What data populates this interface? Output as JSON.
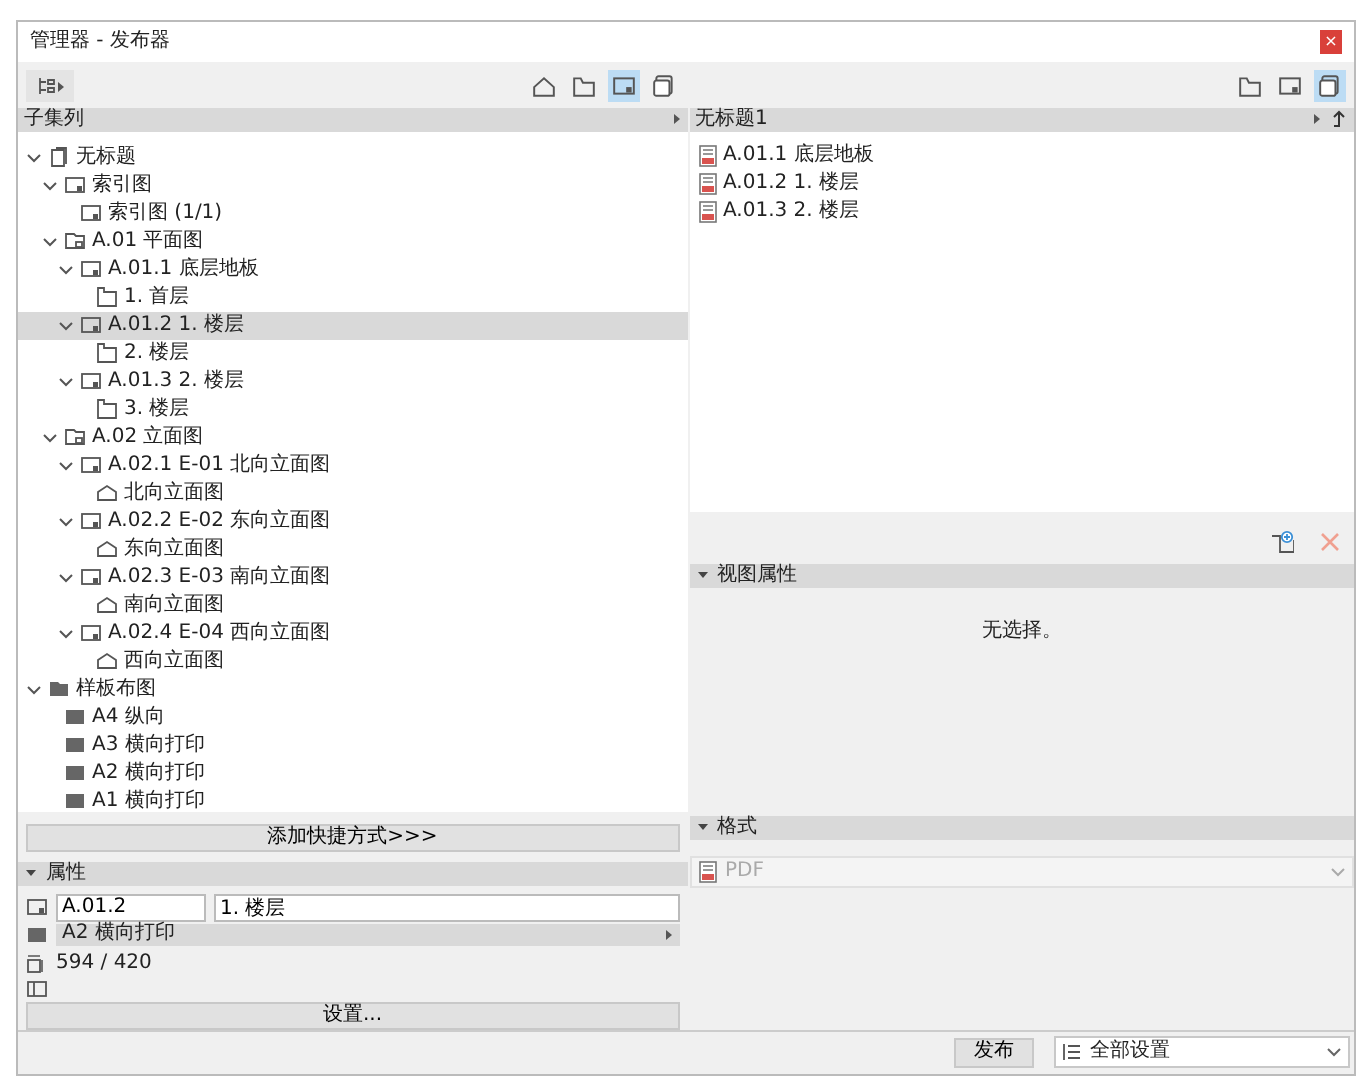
{
  "window": {
    "title": "管理器 - 发布器",
    "close": "×"
  },
  "left_pane": {
    "toolbar": {
      "view_buttons": [
        {
          "kind": "house",
          "selected": false
        },
        {
          "kind": "folder",
          "selected": false
        },
        {
          "kind": "layout",
          "selected": true
        },
        {
          "kind": "stack",
          "selected": false
        }
      ]
    },
    "header": "子集列",
    "tree": [
      {
        "label": "无标题",
        "kind": "book",
        "selected": false,
        "expanded": true,
        "children": [
          {
            "label": "索引图",
            "kind": "layout",
            "selected": false,
            "expanded": true,
            "children": [
              {
                "label": "索引图 (1/1)",
                "kind": "layout",
                "selected": false
              }
            ]
          },
          {
            "label": "A.01 平面图",
            "kind": "subset",
            "selected": false,
            "expanded": true,
            "children": [
              {
                "label": "A.01.1 底层地板",
                "kind": "layout",
                "selected": false,
                "expanded": true,
                "children": [
                  {
                    "label": "1. 首层",
                    "kind": "plan",
                    "selected": false
                  }
                ]
              },
              {
                "label": "A.01.2 1. 楼层",
                "kind": "layout",
                "selected": true,
                "expanded": true,
                "children": [
                  {
                    "label": "2. 楼层",
                    "kind": "plan",
                    "selected": false
                  }
                ]
              },
              {
                "label": "A.01.3 2. 楼层",
                "kind": "layout",
                "selected": false,
                "expanded": true,
                "children": [
                  {
                    "label": "3. 楼层",
                    "kind": "plan",
                    "selected": false
                  }
                ]
              }
            ]
          },
          {
            "label": "A.02 立面图",
            "kind": "subset",
            "selected": false,
            "expanded": true,
            "children": [
              {
                "label": "A.02.1 E-01 北向立面图",
                "kind": "layout",
                "selected": false,
                "expanded": true,
                "children": [
                  {
                    "label": "北向立面图",
                    "kind": "elevation",
                    "selected": false
                  }
                ]
              },
              {
                "label": "A.02.2 E-02 东向立面图",
                "kind": "layout",
                "selected": false,
                "expanded": true,
                "children": [
                  {
                    "label": "东向立面图",
                    "kind": "elevation",
                    "selected": false
                  }
                ]
              },
              {
                "label": "A.02.3 E-03 南向立面图",
                "kind": "layout",
                "selected": false,
                "expanded": true,
                "children": [
                  {
                    "label": "南向立面图",
                    "kind": "elevation",
                    "selected": false
                  }
                ]
              },
              {
                "label": "A.02.4 E-04 西向立面图",
                "kind": "layout",
                "selected": false,
                "expanded": true,
                "children": [
                  {
                    "label": "西向立面图",
                    "kind": "elevation",
                    "selected": false
                  }
                ]
              }
            ]
          }
        ]
      },
      {
        "label": "样板布图",
        "kind": "master_folder",
        "selected": false,
        "expanded": true,
        "children": [
          {
            "label": "A4 纵向",
            "kind": "master",
            "selected": false
          },
          {
            "label": "A3 横向打印",
            "kind": "master",
            "selected": false
          },
          {
            "label": "A2 横向打印",
            "kind": "master",
            "selected": false
          },
          {
            "label": "A1 横向打印",
            "kind": "master",
            "selected": false
          }
        ]
      }
    ],
    "add_shortcut_button": "添加快捷方式>>>",
    "properties": {
      "title": "属性",
      "expanded": true,
      "id_field": "A.01.2",
      "name_field": "1. 楼层",
      "master_layout": "A2 横向打印",
      "size": "594 / 420",
      "settings_button": "设置..."
    }
  },
  "right_pane": {
    "toolbar": {
      "view_buttons": [
        {
          "kind": "folder",
          "selected": false
        },
        {
          "kind": "layout",
          "selected": false
        },
        {
          "kind": "stack",
          "selected": true
        }
      ]
    },
    "header": "无标题1",
    "items": [
      {
        "label": "A.01.1 底层地板"
      },
      {
        "label": "A.01.2 1. 楼层"
      },
      {
        "label": "A.01.3 2. 楼层"
      }
    ],
    "view_properties": {
      "title": "视图属性",
      "expanded": true,
      "message": "无选择。"
    },
    "format": {
      "title": "格式",
      "expanded": true,
      "value": "PDF",
      "disabled": true
    }
  },
  "footer": {
    "publish_button": "发布",
    "settings_dropdown": "全部设置"
  }
}
